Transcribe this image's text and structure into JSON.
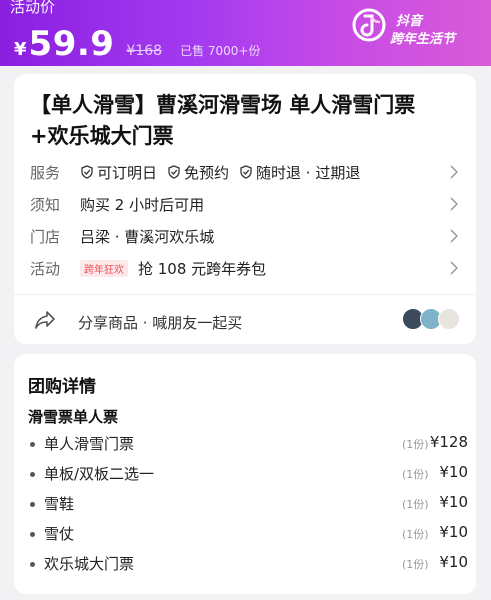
{
  "header": {
    "activity_label": "活动价",
    "currency": "¥",
    "price": "59.9",
    "original_price": "¥168",
    "sold": "已售 7000+份",
    "brand_line1": "抖音",
    "brand_line2": "跨年生活节",
    "gradient_from": "#8a1fe0",
    "gradient_to": "#d85bd8"
  },
  "product": {
    "title": "【单人滑雪】曹溪河滑雪场 单人滑雪门票+欢乐城大门票",
    "rows": [
      {
        "key": "服务",
        "services": [
          "可订明日",
          "免预约",
          "随时退 · 过期退"
        ]
      },
      {
        "key": "须知",
        "value": "购买 2 小时后可用"
      },
      {
        "key": "门店",
        "value": "吕梁 · 曹溪河欢乐城"
      },
      {
        "key": "活动",
        "tag": "跨年狂欢",
        "value": "抢 108 元跨年券包"
      }
    ],
    "share_text": "分享商品 · 喊朋友一起买"
  },
  "details": {
    "section_title": "团购详情",
    "group_title": "滑雪票单人票",
    "items": [
      {
        "name": "单人滑雪门票",
        "qty": "(1份)",
        "price": "¥128"
      },
      {
        "name": "单板/双板二选一",
        "qty": "(1份)",
        "price": "¥10"
      },
      {
        "name": "雪鞋",
        "qty": "(1份)",
        "price": "¥10"
      },
      {
        "name": "雪仗",
        "qty": "(1份)",
        "price": "¥10"
      },
      {
        "name": "欢乐城大门票",
        "qty": "(1份)",
        "price": "¥10"
      }
    ]
  },
  "icons": {
    "check": "check-circle-icon",
    "chevron": "chevron-right-icon",
    "share": "share-arrow-icon",
    "brand": "douyin-logo-icon"
  },
  "colors": {
    "accent": "#a43bf0",
    "tag_text": "#e8545c",
    "tag_bg": "#fde8ea"
  }
}
